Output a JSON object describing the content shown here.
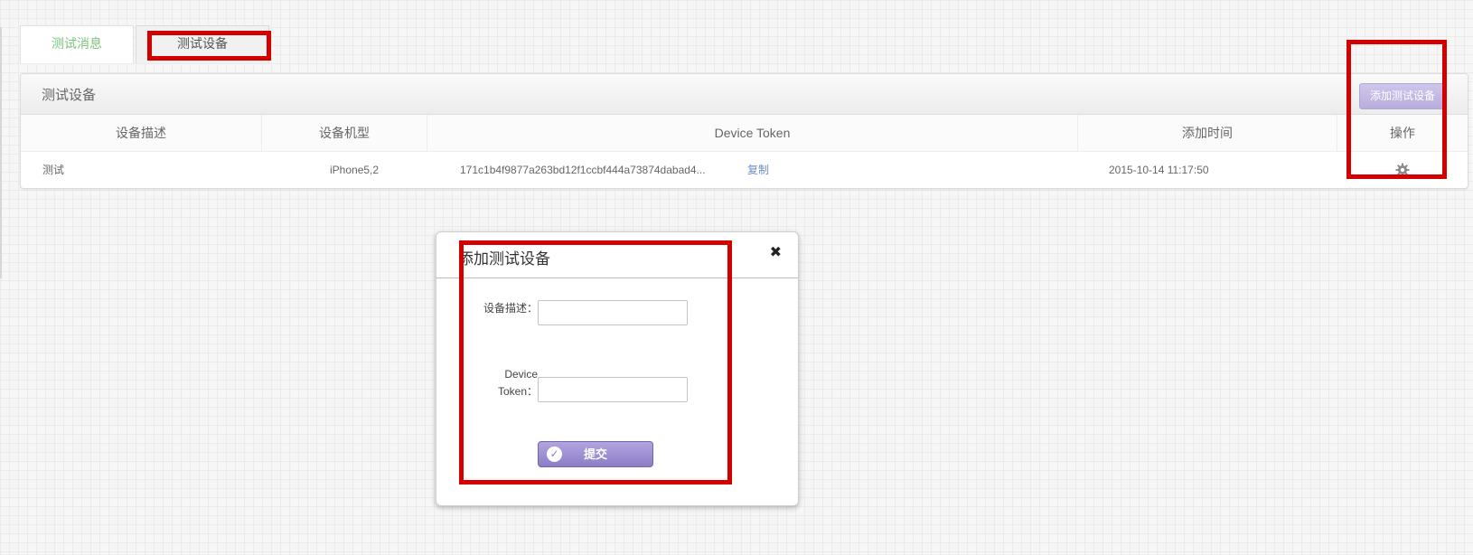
{
  "tabs": [
    {
      "label": "测试消息",
      "active": false
    },
    {
      "label": "测试设备",
      "active": true
    }
  ],
  "panel": {
    "title": "测试设备",
    "add_button_label": "添加测试设备"
  },
  "table": {
    "headers": [
      "设备描述",
      "设备机型",
      "Device Token",
      "添加时间",
      "操作"
    ],
    "rows": [
      {
        "description": "测试",
        "model": "iPhone5,2",
        "token": "171c1b4f9877a263bd12f1ccbf444a73874dabad4...",
        "copy_label": "复制",
        "added_time": "2015-10-14 11:17:50",
        "action_icon": "gear-icon"
      }
    ]
  },
  "modal": {
    "title": "添加测试设备",
    "close_glyph": "✖",
    "description_label": "设备描述：",
    "description_value": "",
    "token_label_line1": "Device",
    "token_label_line2": "Token：",
    "token_value": "",
    "submit_label": "提交",
    "submit_icon": "check-circle-icon"
  },
  "colors": {
    "annotation_red": "#d40000",
    "accent_purple": "#8d7dc8",
    "active_tab_green": "#7ac77a",
    "link_blue": "#6f8fc7"
  }
}
